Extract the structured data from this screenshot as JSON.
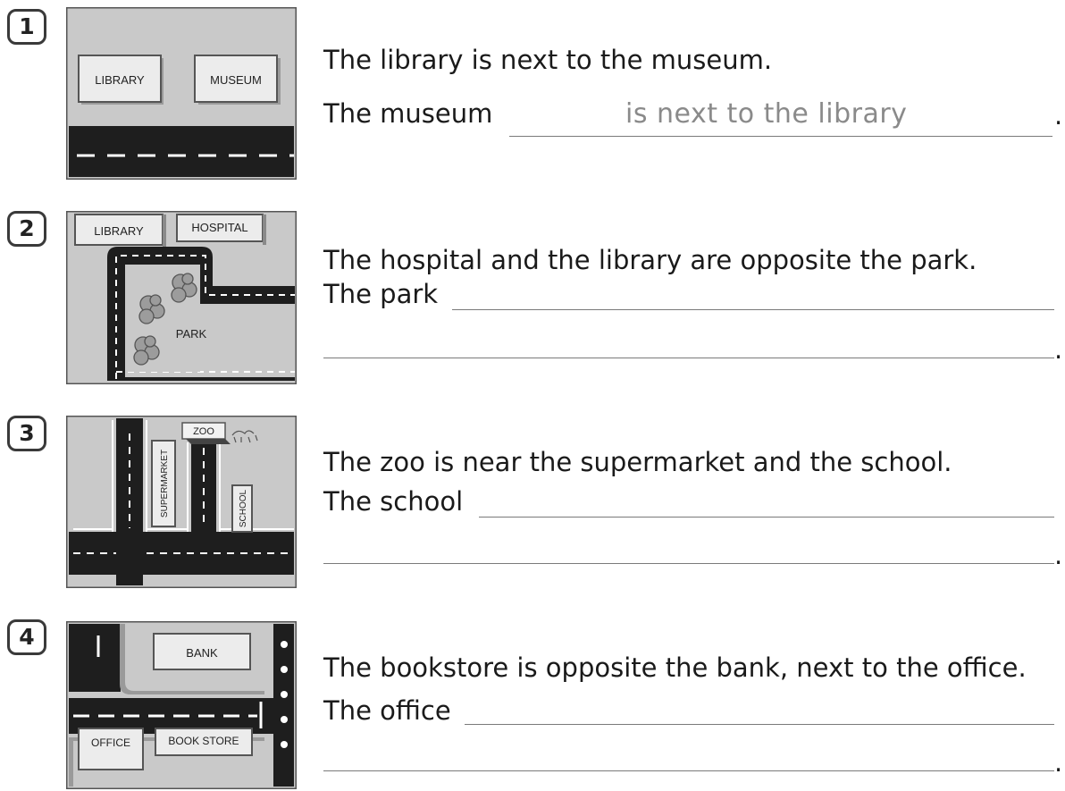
{
  "exercises": [
    {
      "number": "1",
      "map": {
        "labels": [
          "LIBRARY",
          "MUSEUM"
        ]
      },
      "sentence": "The library is next to the museum.",
      "prompt": "The museum",
      "answer": "is next to the library",
      "end": "."
    },
    {
      "number": "2",
      "map": {
        "labels": [
          "LIBRARY",
          "HOSPITAL",
          "PARK"
        ]
      },
      "sentence": "The hospital and the library are opposite the park.",
      "prompt": "The park",
      "answer": "",
      "end": "."
    },
    {
      "number": "3",
      "map": {
        "labels": [
          "ZOO",
          "SUPERMARKET",
          "SCHOOL"
        ]
      },
      "sentence": "The zoo is near the supermarket and the school.",
      "prompt": "The school",
      "answer": "",
      "end": "."
    },
    {
      "number": "4",
      "map": {
        "labels": [
          "BANK",
          "OFFICE",
          "BOOK STORE"
        ]
      },
      "sentence": "The bookstore is opposite the bank, next to the office.",
      "prompt": "The office",
      "answer": "",
      "end": "."
    }
  ]
}
